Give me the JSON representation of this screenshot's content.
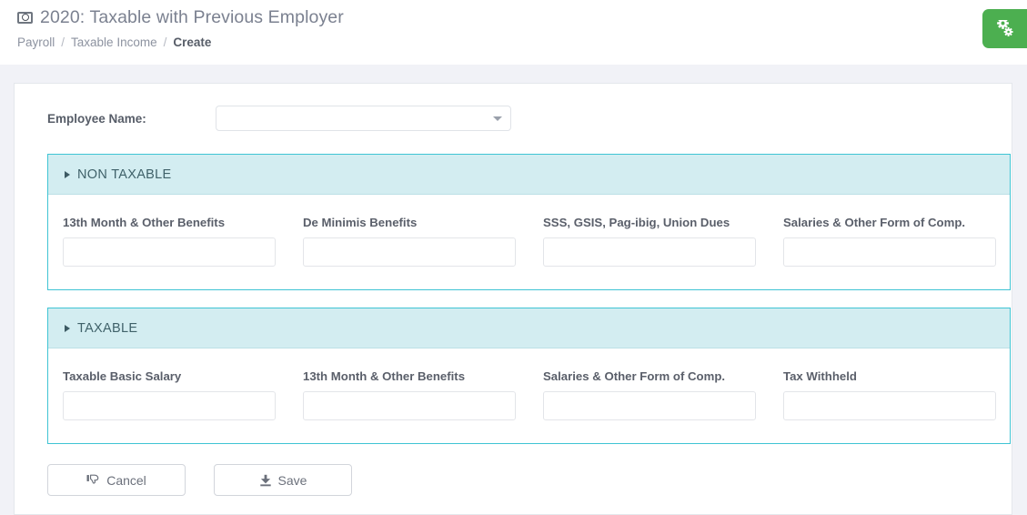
{
  "header": {
    "icon": "money-bill-icon",
    "title": "2020: Taxable with Previous Employer",
    "breadcrumb": [
      {
        "label": "Payroll",
        "active": false
      },
      {
        "label": "Taxable Income",
        "active": false
      },
      {
        "label": "Create",
        "active": true
      }
    ],
    "separator": "/",
    "settings_button": {
      "icon": "gears-icon",
      "color": "#4caf50"
    }
  },
  "form": {
    "employee": {
      "label": "Employee Name:",
      "selected_value": "",
      "placeholder": "",
      "caret_icon": "chevron-down-icon"
    },
    "panels": [
      {
        "title": "NON TAXABLE",
        "caret_icon": "caret-right-icon",
        "fields": [
          {
            "label": "13th Month & Other Benefits",
            "value": ""
          },
          {
            "label": "De Minimis Benefits",
            "value": ""
          },
          {
            "label": "SSS, GSIS, Pag-ibig, Union Dues",
            "value": ""
          },
          {
            "label": "Salaries & Other Form of Comp.",
            "value": ""
          }
        ]
      },
      {
        "title": "TAXABLE",
        "caret_icon": "caret-right-icon",
        "fields": [
          {
            "label": "Taxable Basic Salary",
            "value": ""
          },
          {
            "label": "13th Month & Other Benefits",
            "value": ""
          },
          {
            "label": "Salaries & Other Form of Comp.",
            "value": ""
          },
          {
            "label": "Tax Withheld",
            "value": ""
          }
        ]
      }
    ],
    "actions": {
      "cancel": {
        "label": "Cancel",
        "icon": "thumbs-down-icon"
      },
      "save": {
        "label": "Save",
        "icon": "download-icon"
      }
    }
  },
  "colors": {
    "panel_border": "#3fc4d4",
    "panel_header_bg": "#d3edf1",
    "accent_green": "#4caf50",
    "page_bg": "#f1f2f7"
  }
}
